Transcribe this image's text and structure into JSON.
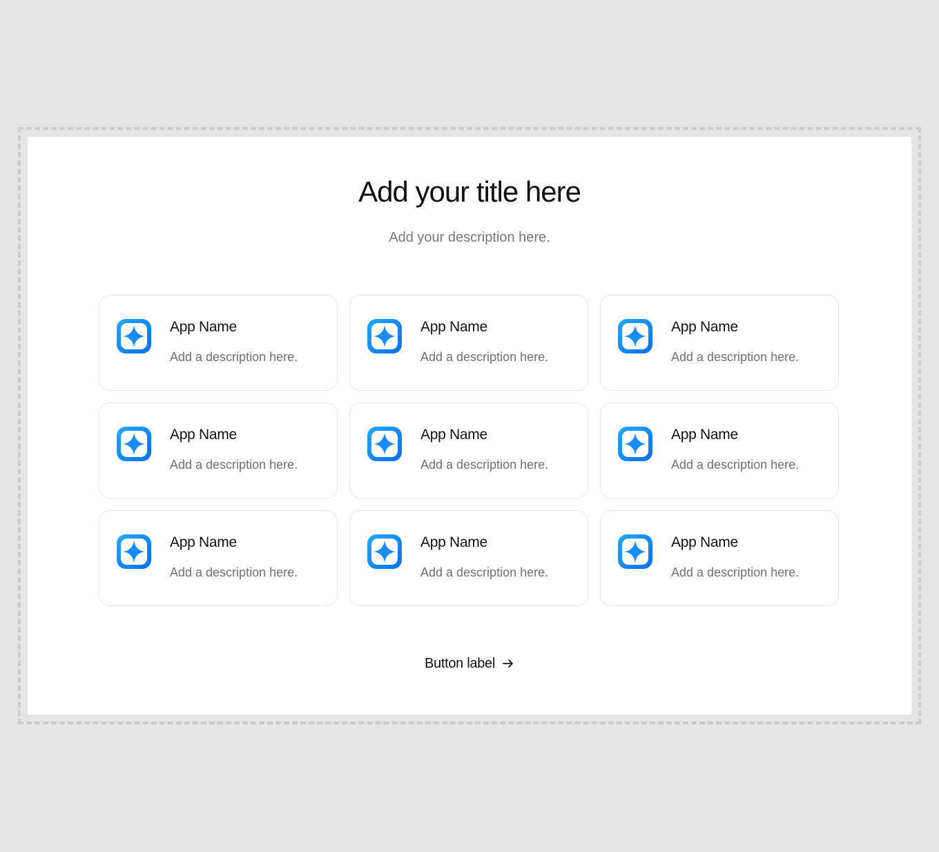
{
  "header": {
    "title": "Add your title here",
    "description": "Add your description here."
  },
  "apps": [
    {
      "name": "App Name",
      "description": "Add a description here.",
      "icon": "sparkle-app-icon"
    },
    {
      "name": "App Name",
      "description": "Add a description here.",
      "icon": "sparkle-app-icon"
    },
    {
      "name": "App Name",
      "description": "Add a description here.",
      "icon": "sparkle-app-icon"
    },
    {
      "name": "App Name",
      "description": "Add a description here.",
      "icon": "sparkle-app-icon"
    },
    {
      "name": "App Name",
      "description": "Add a description here.",
      "icon": "sparkle-app-icon"
    },
    {
      "name": "App Name",
      "description": "Add a description here.",
      "icon": "sparkle-app-icon"
    },
    {
      "name": "App Name",
      "description": "Add a description here.",
      "icon": "sparkle-app-icon"
    },
    {
      "name": "App Name",
      "description": "Add a description here.",
      "icon": "sparkle-app-icon"
    },
    {
      "name": "App Name",
      "description": "Add a description here.",
      "icon": "sparkle-app-icon"
    }
  ],
  "cta": {
    "label": "Button label",
    "icon": "arrow-right-icon"
  },
  "colors": {
    "background": "#e5e5e5",
    "canvas": "#ffffff",
    "icon_blue": "#1a8cff"
  }
}
